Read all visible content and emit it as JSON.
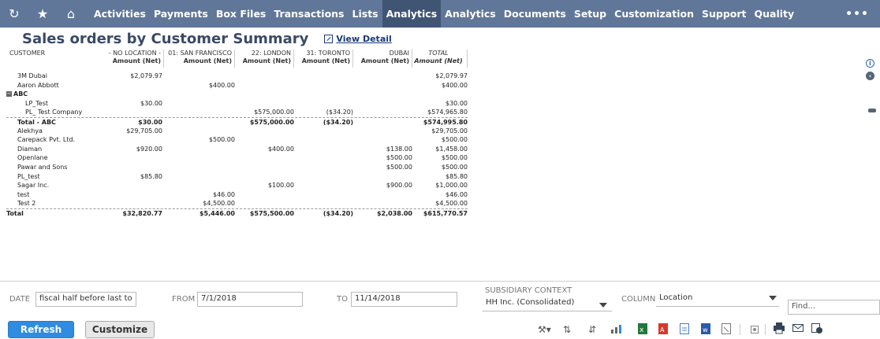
{
  "nav": {
    "icons": [
      "recent-icon",
      "star-icon",
      "home-icon"
    ],
    "items": [
      "Activities",
      "Payments",
      "Box Files",
      "Transactions",
      "Lists",
      "Analytics",
      "Analytics",
      "Documents",
      "Setup",
      "Customization",
      "Support",
      "Quality"
    ],
    "active_index": 5,
    "more": "•••"
  },
  "title": "Sales orders by Customer Summary",
  "view_detail": "View Detail",
  "columns": [
    {
      "line1": "CUSTOMER",
      "line2": ""
    },
    {
      "line1": "- NO LOCATION -",
      "line2": "Amount (Net)"
    },
    {
      "line1": "01: SAN FRANCISCO",
      "line2": "Amount (Net)"
    },
    {
      "line1": "22: LONDON",
      "line2": "Amount (Net)"
    },
    {
      "line1": "31: TORONTO",
      "line2": "Amount (Net)"
    },
    {
      "line1": "DUBAI",
      "line2": "Amount (Net)"
    },
    {
      "line1": "TOTAL",
      "line2": "Amount (Net)"
    }
  ],
  "rows": [
    {
      "name": "3M Dubai",
      "vals": [
        "$2,079.97",
        "",
        "",
        "",
        "",
        "$2,079.97"
      ]
    },
    {
      "name": "Aaron Abbott",
      "vals": [
        "",
        "$400.00",
        "",
        "",
        "",
        "$400.00"
      ]
    },
    {
      "name": "ABC",
      "vals": [
        "",
        "",
        "",
        "",
        "",
        ""
      ],
      "group": true
    },
    {
      "name": "LP_Test",
      "vals": [
        "$30.00",
        "",
        "",
        "",
        "",
        "$30.00"
      ],
      "indent": 2
    },
    {
      "name": "PL_ Test Company",
      "vals": [
        "",
        "",
        "$575,000.00",
        "($34.20)",
        "",
        "$574,965.80"
      ],
      "indent": 2
    },
    {
      "name": "Total - ABC",
      "vals": [
        "$30.00",
        "",
        "$575,000.00",
        "($34.20)",
        "",
        "$574,995.80"
      ],
      "bold": true,
      "subtotal": true
    },
    {
      "name": "Alekhya",
      "vals": [
        "$29,705.00",
        "",
        "",
        "",
        "",
        "$29,705.00"
      ]
    },
    {
      "name": "Carepack Pvt. Ltd.",
      "vals": [
        "",
        "$500.00",
        "",
        "",
        "",
        "$500.00"
      ]
    },
    {
      "name": "Diaman",
      "vals": [
        "$920.00",
        "",
        "$400.00",
        "",
        "$138.00",
        "$1,458.00"
      ]
    },
    {
      "name": "Openlane",
      "vals": [
        "",
        "",
        "",
        "",
        "$500.00",
        "$500.00"
      ]
    },
    {
      "name": "Pawar and Sons",
      "vals": [
        "",
        "",
        "",
        "",
        "$500.00",
        "$500.00"
      ]
    },
    {
      "name": "PL_test",
      "vals": [
        "$85.80",
        "",
        "",
        "",
        "",
        "$85.80"
      ]
    },
    {
      "name": "Sagar Inc.",
      "vals": [
        "",
        "",
        "$100.00",
        "",
        "$900.00",
        "$1,000.00"
      ]
    },
    {
      "name": "test",
      "vals": [
        "",
        "$46.00",
        "",
        "",
        "",
        "$46.00"
      ]
    },
    {
      "name": "Test 2",
      "vals": [
        "",
        "$4,500.00",
        "",
        "",
        "",
        "$4,500.00"
      ]
    },
    {
      "name": "Total",
      "vals": [
        "$32,820.77",
        "$5,446.00",
        "$575,500.00",
        "($34.20)",
        "$2,038.00",
        "$615,770.57"
      ],
      "bold": true,
      "grand": true
    }
  ],
  "filters": {
    "date_label": "DATE",
    "date_value": "fiscal half before last to",
    "from_label": "FROM",
    "from_value": "7/1/2018",
    "to_label": "TO",
    "to_value": "11/14/2018",
    "subsidiary_label": "SUBSIDIARY CONTEXT",
    "subsidiary_value": "HH Inc. (Consolidated)",
    "column_label": "COLUMN",
    "column_value": "Location",
    "find_placeholder": "Find..."
  },
  "buttons": {
    "refresh": "Refresh",
    "customize": "Customize"
  }
}
